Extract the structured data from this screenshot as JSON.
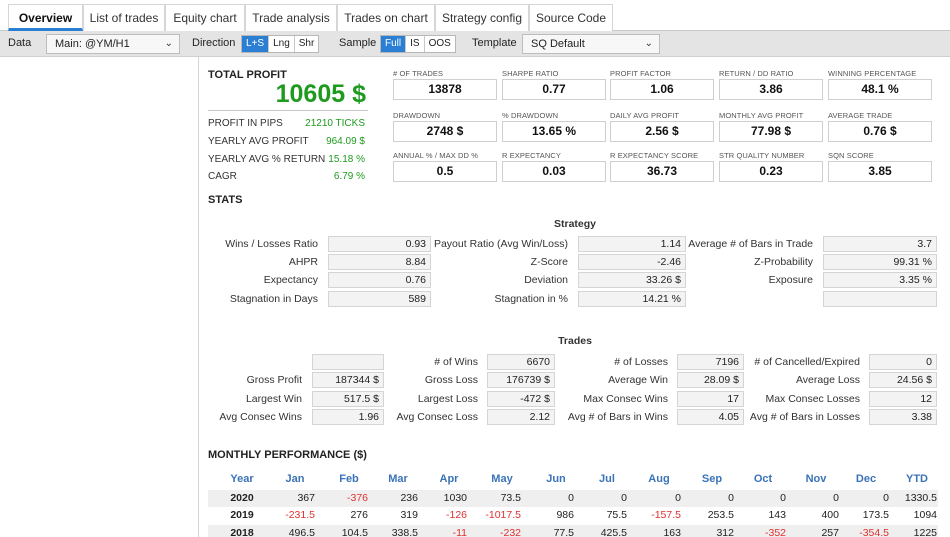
{
  "tabs": [
    {
      "label": "Overview",
      "active": true
    },
    {
      "label": "List of trades"
    },
    {
      "label": "Equity chart"
    },
    {
      "label": "Trade analysis"
    },
    {
      "label": "Trades on chart"
    },
    {
      "label": "Strategy config"
    },
    {
      "label": "Source Code"
    }
  ],
  "toolbar": {
    "data_label": "Data",
    "data_value": "Main: @YM/H1",
    "direction_label": "Direction",
    "direction_options": [
      "L+S",
      "Lng",
      "Shr"
    ],
    "direction_selected": "L+S",
    "sample_label": "Sample",
    "sample_options": [
      "Full",
      "IS",
      "OOS"
    ],
    "sample_selected": "Full",
    "template_label": "Template",
    "template_value": "SQ Default"
  },
  "total_profit": {
    "title": "TOTAL PROFIT",
    "value": "10605 $",
    "rows": [
      {
        "label": "PROFIT IN PIPS",
        "value": "21210 TICKS"
      },
      {
        "label": "YEARLY AVG PROFIT",
        "value": "964.09 $"
      },
      {
        "label": "YEARLY AVG % RETURN",
        "value": "15.18 %"
      },
      {
        "label": "CAGR",
        "value": "6.79 %"
      }
    ]
  },
  "metrics": [
    [
      {
        "label": "# OF TRADES",
        "value": "13878"
      },
      {
        "label": "SHARPE RATIO",
        "value": "0.77"
      },
      {
        "label": "PROFIT FACTOR",
        "value": "1.06"
      },
      {
        "label": "RETURN / DD RATIO",
        "value": "3.86"
      },
      {
        "label": "WINNING PERCENTAGE",
        "value": "48.1 %"
      }
    ],
    [
      {
        "label": "DRAWDOWN",
        "value": "2748 $"
      },
      {
        "label": "% DRAWDOWN",
        "value": "13.65 %"
      },
      {
        "label": "DAILY AVG PROFIT",
        "value": "2.56 $"
      },
      {
        "label": "MONTHLY AVG PROFIT",
        "value": "77.98 $"
      },
      {
        "label": "AVERAGE TRADE",
        "value": "0.76 $"
      }
    ],
    [
      {
        "label": "ANNUAL % / MAX DD %",
        "value": "0.5"
      },
      {
        "label": "R EXPECTANCY",
        "value": "0.03"
      },
      {
        "label": "R EXPECTANCY SCORE",
        "value": "36.73"
      },
      {
        "label": "STR QUALITY NUMBER",
        "value": "0.23"
      },
      {
        "label": "SQN SCORE",
        "value": "3.85"
      }
    ]
  ],
  "stats": {
    "title": "STATS",
    "strategy_title": "Strategy",
    "strategy_rows": [
      [
        [
          "Wins / Losses Ratio",
          "0.93"
        ],
        [
          "Payout Ratio (Avg Win/Loss)",
          "1.14"
        ],
        [
          "Average # of Bars in Trade",
          "3.7"
        ]
      ],
      [
        [
          "AHPR",
          "8.84"
        ],
        [
          "Z-Score",
          "-2.46"
        ],
        [
          "Z-Probability",
          "99.31 %"
        ]
      ],
      [
        [
          "Expectancy",
          "0.76"
        ],
        [
          "Deviation",
          "33.26 $"
        ],
        [
          "Exposure",
          "3.35 %"
        ]
      ],
      [
        [
          "Stagnation in Days",
          "589"
        ],
        [
          "Stagnation in %",
          "14.21 %"
        ],
        [
          "",
          ""
        ]
      ]
    ],
    "trades_title": "Trades",
    "trades_rows": [
      [
        [
          "",
          ""
        ],
        [
          "# of Wins",
          "6670"
        ],
        [
          "# of Losses",
          "7196"
        ],
        [
          "# of Cancelled/Expired",
          "0"
        ]
      ],
      [
        [
          "Gross Profit",
          "187344 $"
        ],
        [
          "Gross Loss",
          "176739 $"
        ],
        [
          "Average Win",
          "28.09 $"
        ],
        [
          "Average Loss",
          "24.56 $"
        ]
      ],
      [
        [
          "Largest Win",
          "517.5 $"
        ],
        [
          "Largest Loss",
          "-472 $"
        ],
        [
          "Max Consec Wins",
          "17"
        ],
        [
          "Max Consec Losses",
          "12"
        ]
      ],
      [
        [
          "Avg Consec Wins",
          "1.96"
        ],
        [
          "Avg Consec Loss",
          "2.12"
        ],
        [
          "Avg # of Bars in Wins",
          "4.05"
        ],
        [
          "Avg # of Bars in Losses",
          "3.38"
        ]
      ]
    ]
  },
  "monthly": {
    "title": "MONTHLY PERFORMANCE ($)",
    "headers": [
      "Year",
      "Jan",
      "Feb",
      "Mar",
      "Apr",
      "May",
      "Jun",
      "Jul",
      "Aug",
      "Sep",
      "Oct",
      "Nov",
      "Dec",
      "YTD"
    ],
    "rows": [
      [
        "2020",
        "367",
        "-376",
        "236",
        "1030",
        "73.5",
        "0",
        "0",
        "0",
        "0",
        "0",
        "0",
        "0",
        "1330.5"
      ],
      [
        "2019",
        "-231.5",
        "276",
        "319",
        "-126",
        "-1017.5",
        "986",
        "75.5",
        "-157.5",
        "253.5",
        "143",
        "400",
        "173.5",
        "1094"
      ],
      [
        "2018",
        "496.5",
        "104.5",
        "338.5",
        "-11",
        "-232",
        "77.5",
        "425.5",
        "163",
        "312",
        "-352",
        "257",
        "-354.5",
        "1225"
      ]
    ]
  },
  "colors": {
    "accent": "#2a7fd4",
    "profit": "#1e9a1e",
    "negative": "#e03030",
    "header_blue": "#3a73b8"
  }
}
